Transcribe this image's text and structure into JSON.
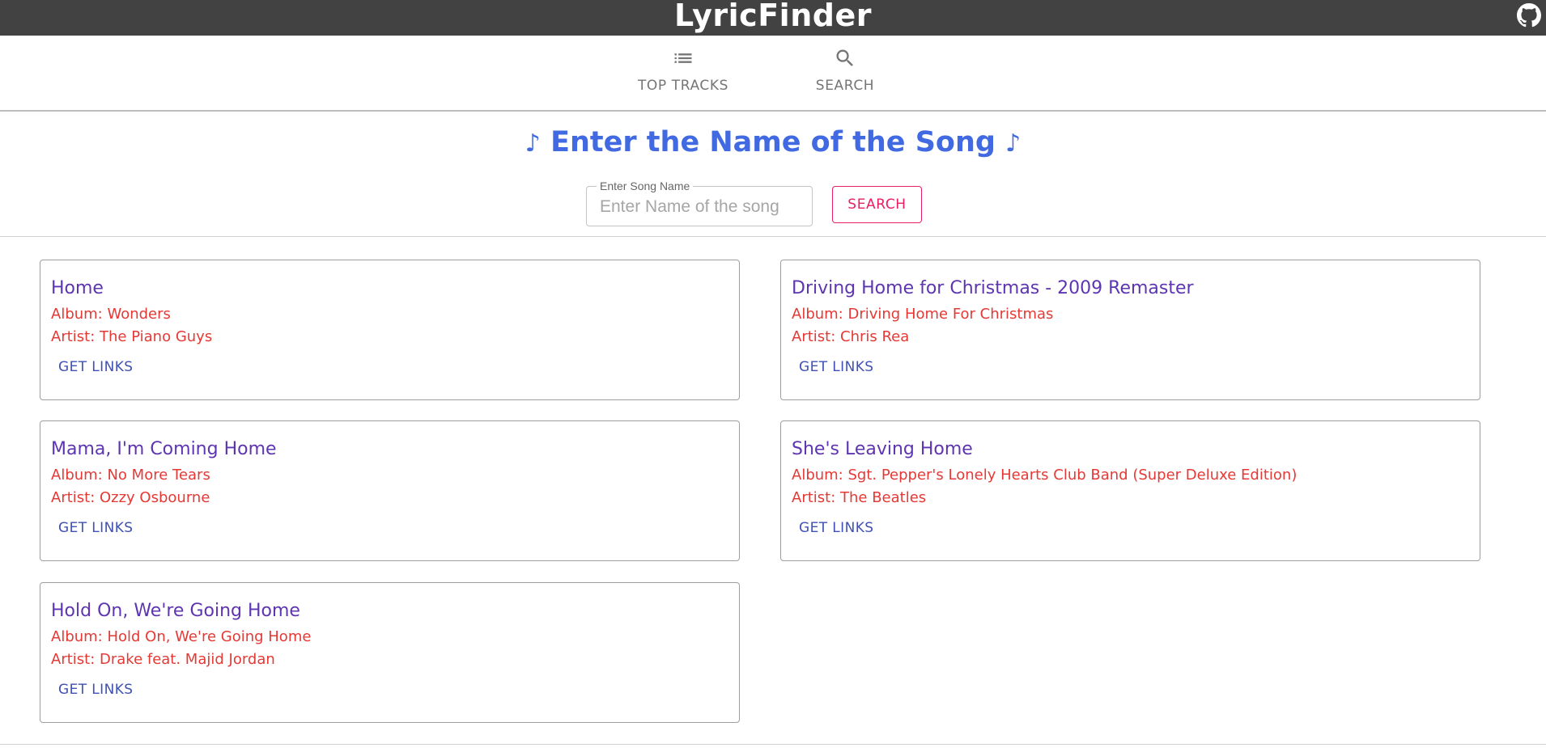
{
  "header": {
    "title": "LyricFinder",
    "github_icon": "github-icon"
  },
  "nav": {
    "tabs": [
      {
        "label": "TOP TRACKS",
        "icon": "list-icon"
      },
      {
        "label": "SEARCH",
        "icon": "search-icon"
      }
    ]
  },
  "search": {
    "heading": "Enter the Name of the Song",
    "note_symbol": "♪",
    "field_label": "Enter Song Name",
    "placeholder": "Enter Name of the song",
    "value": "",
    "button_label": "SEARCH"
  },
  "colors": {
    "appbar": "#424242",
    "heading": "#4169e1",
    "song_title": "#5e35b1",
    "details": "#e53935",
    "link": "#3f51b5",
    "search_button": "#e91e63"
  },
  "results": [
    {
      "title": "Home",
      "album": "Album: Wonders",
      "artist": "Artist: The Piano Guys",
      "action": "GET LINKS"
    },
    {
      "title": "Driving Home for Christmas - 2009 Remaster",
      "album": "Album: Driving Home For Christmas",
      "artist": "Artist: Chris Rea",
      "action": "GET LINKS"
    },
    {
      "title": "Mama, I'm Coming Home",
      "album": "Album: No More Tears",
      "artist": "Artist: Ozzy Osbourne",
      "action": "GET LINKS"
    },
    {
      "title": "She's Leaving Home",
      "album": "Album: Sgt. Pepper's Lonely Hearts Club Band (Super Deluxe Edition)",
      "artist": "Artist: The Beatles",
      "action": "GET LINKS"
    },
    {
      "title": "Hold On, We're Going Home",
      "album": "Album: Hold On, We're Going Home",
      "artist": "Artist: Drake feat. Majid Jordan",
      "action": "GET LINKS"
    }
  ]
}
